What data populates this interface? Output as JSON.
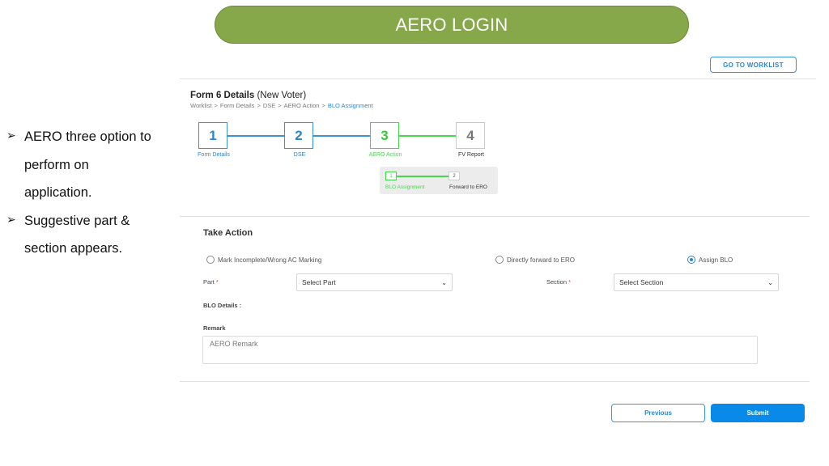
{
  "banner": {
    "title": "AERO LOGIN"
  },
  "notes": [
    {
      "icon": "arrow-bullet-icon",
      "lines": [
        "AERO three option to",
        "perform on",
        "application."
      ]
    },
    {
      "icon": "arrow-bullet-icon",
      "lines": [
        "Suggestive part &",
        "section appears."
      ]
    }
  ],
  "header": {
    "worklist_button": "GO TO WORKLIST",
    "form_title_bold": "Form 6 Details",
    "form_title_rest": " (New Voter)",
    "breadcrumb": [
      "Worklist",
      ">",
      "Form Details",
      ">",
      "DSE",
      ">",
      "AERO Action",
      ">",
      "BLO Assignment"
    ]
  },
  "colors": {
    "banner_green": "#87a84a",
    "step_blue": "#3a93d9",
    "step_green": "#44d94a",
    "step_grey": "#c8c8c8",
    "primary_blue": "#0a8ae8"
  },
  "steps": [
    {
      "number": "1",
      "label": "Form Details",
      "state": "completed"
    },
    {
      "number": "2",
      "label": "DSE",
      "state": "completed"
    },
    {
      "number": "3",
      "label": "AERO Action",
      "state": "active"
    },
    {
      "number": "4",
      "label": "FV Report",
      "state": "pending"
    }
  ],
  "substeps": [
    {
      "number": "1",
      "label": "BLO Assignment",
      "state": "active"
    },
    {
      "number": "2",
      "label": "Forward to ERO",
      "state": "pending"
    }
  ],
  "take_action": {
    "title": "Take Action",
    "options": [
      {
        "label": "Mark Incomplete/Wrong AC Marking",
        "checked": false
      },
      {
        "label": "Directly forward to ERO",
        "checked": false
      },
      {
        "label": "Assign BLO",
        "checked": true
      }
    ],
    "part": {
      "label": "Part",
      "required_mark": "*",
      "value": "Select Part"
    },
    "section": {
      "label": "Section",
      "required_mark": "*",
      "value": "Select Section"
    },
    "blo_details_label": "BLO Details :",
    "remark": {
      "label": "Remark",
      "placeholder": "AERO Remark",
      "value": ""
    }
  },
  "footer": {
    "previous": "Previous",
    "submit": "Submit"
  }
}
